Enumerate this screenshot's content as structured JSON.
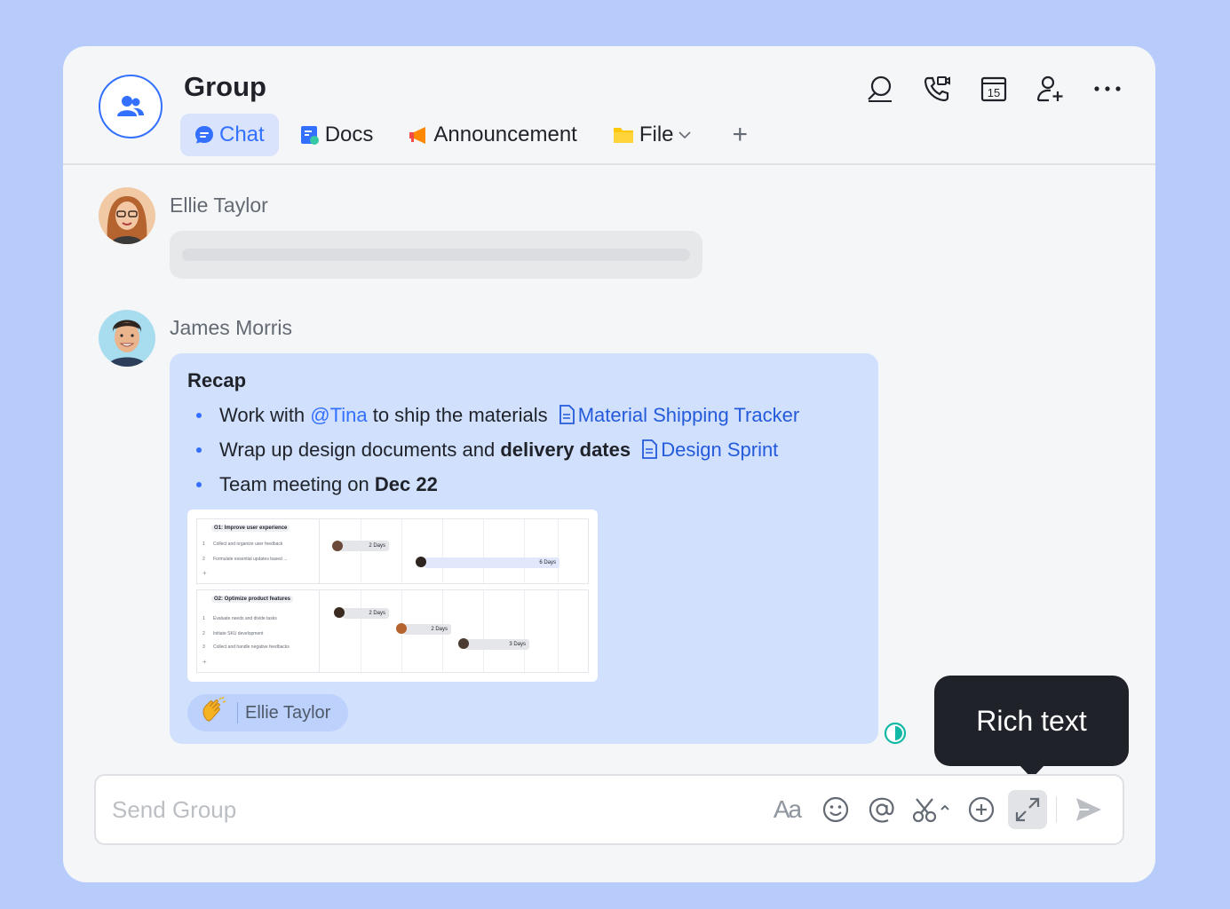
{
  "header": {
    "title": "Group",
    "tabs": [
      {
        "label": "Chat",
        "icon": "chat-bubble-icon",
        "active": true
      },
      {
        "label": "Docs",
        "icon": "docs-icon",
        "active": false
      },
      {
        "label": "Announcement",
        "icon": "megaphone-icon",
        "active": false
      },
      {
        "label": "File",
        "icon": "folder-icon",
        "active": false
      }
    ],
    "add_tab": "+",
    "actions": [
      "search-icon",
      "video-call-icon",
      "calendar-icon",
      "add-member-icon",
      "more-icon"
    ],
    "calendar_day": "15"
  },
  "messages": [
    {
      "sender": "Ellie Taylor",
      "content": ""
    },
    {
      "sender": "James Morris",
      "recap": {
        "title": "Recap",
        "items": [
          {
            "pre": "Work with ",
            "mention": "@Tina",
            "mid": " to ship the materials",
            "doc": "Material Shipping Tracker"
          },
          {
            "pre": "Wrap up design documents and ",
            "bold": "delivery dates",
            "doc": "Design Sprint"
          },
          {
            "pre": "Team meeting on ",
            "bold": "Dec 22"
          }
        ]
      },
      "preview": {
        "sections": [
          {
            "title": "O1: Improve user experience",
            "rows": [
              "Collect and organize user feedback",
              "Formulate essential updates based ..."
            ],
            "bars": [
              "2 Days",
              "6 Days"
            ]
          },
          {
            "title": "O2: Optimize product features",
            "rows": [
              "Evaluate needs and divide tasks",
              "Initiate SKU development",
              "Collect and handle negative feedbacks"
            ],
            "bars": [
              "2 Days",
              "2 Days",
              "3 Days"
            ]
          }
        ],
        "row_numbers": [
          "1",
          "2",
          "1",
          "2",
          "3"
        ]
      },
      "reaction": {
        "emoji": "clapping-hands-icon",
        "user": "Ellie Taylor"
      }
    }
  ],
  "tooltip": "Rich text",
  "input": {
    "placeholder": "Send Group",
    "value": "",
    "format_label": "Aa",
    "tools": [
      "text-format-icon",
      "emoji-icon",
      "mention-icon",
      "screenshot-icon",
      "add-icon",
      "expand-icon",
      "send-icon"
    ]
  },
  "colors": {
    "background": "#b7ccfb",
    "accent": "#3370ff",
    "bubble": "#d1e0fd",
    "tooltip": "#1f2329"
  }
}
